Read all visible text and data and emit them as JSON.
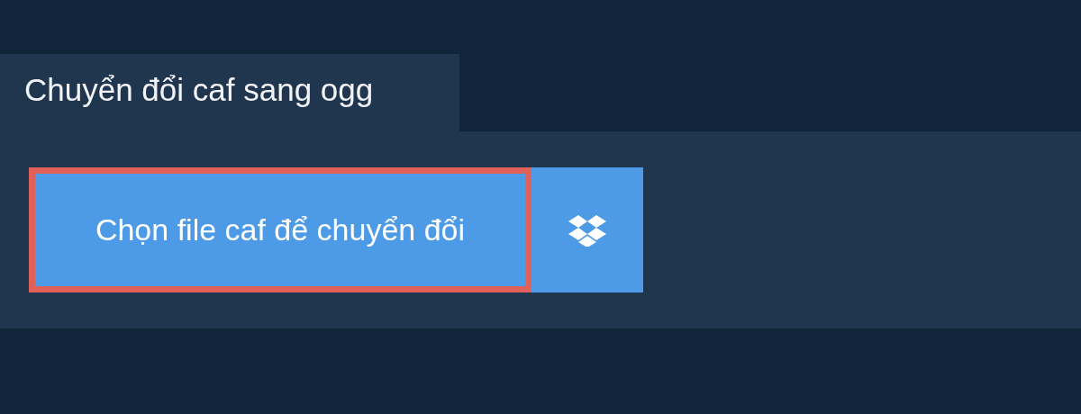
{
  "tab": {
    "title": "Chuyển đổi caf sang ogg"
  },
  "buttons": [
    {
      "kind": "text",
      "label": "Chọn file caf để chuyển đổi",
      "focused": true
    },
    {
      "kind": "icon",
      "focused": false
    }
  ]
}
